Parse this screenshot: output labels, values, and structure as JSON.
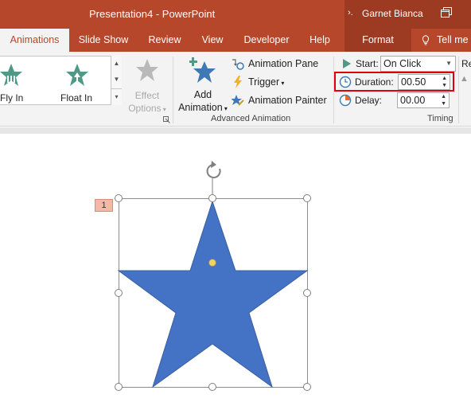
{
  "titlebar": {
    "title": "Presentation4  -  PowerPoint",
    "collapse_glyph": "›.",
    "user": "Garnet Bianca",
    "restore_icon": "restore-window-icon"
  },
  "tabs": [
    {
      "label": "Animations",
      "active": true
    },
    {
      "label": "Slide Show"
    },
    {
      "label": "Review"
    },
    {
      "label": "View"
    },
    {
      "label": "Developer"
    },
    {
      "label": "Help"
    },
    {
      "label": "Format"
    }
  ],
  "tellme": "Tell me",
  "ribbon": {
    "gallery": [
      {
        "label": "Fly In",
        "icon": "fly-in-star-icon"
      },
      {
        "label": "Float In",
        "icon": "float-in-star-icon"
      }
    ],
    "effect_options": {
      "line1": "Effect",
      "line2": "Options"
    },
    "add_animation": {
      "line1": "Add",
      "line2": "Animation"
    },
    "animation_pane": "Animation Pane",
    "trigger": "Trigger",
    "animation_painter": "Animation Painter",
    "advanced_group_label": "Advanced Animation",
    "timing": {
      "start_label": "Start:",
      "start_value": "On Click",
      "duration_label": "Duration:",
      "duration_value": "00.50",
      "delay_label": "Delay:",
      "delay_value": "00.00",
      "group_label": "Timing"
    },
    "reorder_stub": "Re"
  },
  "slide": {
    "anim_tag": "1"
  },
  "colors": {
    "accent": "#b7472a",
    "star_fill": "#4472c4",
    "highlight": "#e0000b"
  }
}
